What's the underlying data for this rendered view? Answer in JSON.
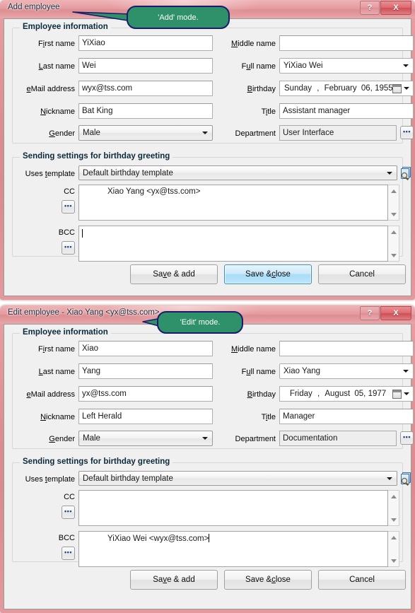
{
  "theme": {
    "frame_color": "#dd8e92",
    "callout_fill": "#2e9169",
    "callout_border": "#1b1b6e",
    "default_button_accent": "#a8dcf7"
  },
  "windows": [
    {
      "id": "add-employee",
      "title": "Add employee",
      "callout": "'Add' mode.",
      "caption": {
        "help": "?",
        "close": "X"
      },
      "groups": {
        "employee": {
          "title": "Employee information",
          "fields": {
            "first_name": {
              "label_pre": "F",
              "label_key": "i",
              "label_post": "rst name",
              "value": "YiXiao"
            },
            "last_name": {
              "label_pre": "",
              "label_key": "L",
              "label_post": "ast name",
              "value": "Wei"
            },
            "email": {
              "label_pre": "",
              "label_key": "e",
              "label_post": "Mail address",
              "value": "wyx@tss.com"
            },
            "nickname": {
              "label_pre": "",
              "label_key": "N",
              "label_post": "ickname",
              "value": "Bat King"
            },
            "gender": {
              "label_pre": "",
              "label_key": "G",
              "label_post": "ender",
              "value": "Male"
            },
            "middle_name": {
              "label_pre": "",
              "label_key": "M",
              "label_post": "iddle name",
              "value": ""
            },
            "full_name": {
              "label_pre": "F",
              "label_key": "u",
              "label_post": "ll name",
              "value": "YiXiao Wei"
            },
            "birthday": {
              "label_pre": "",
              "label_key": "B",
              "label_post": "irthday",
              "weekday": "Sunday",
              "comma": ",",
              "month": "February",
              "day": "06,",
              "year": "1955"
            },
            "title_field": {
              "label_pre": "T",
              "label_key": "i",
              "label_post": "tle",
              "value": "Assistant manager"
            },
            "department": {
              "label_pre": "",
              "label_key": "",
              "label_post": "Department",
              "value": "User Interface"
            }
          }
        },
        "sending": {
          "title": "Sending settings for birthday greeting",
          "fields": {
            "template": {
              "label_pre": "Uses ",
              "label_key": "t",
              "label_post": "emplate",
              "value": "Default birthday template"
            },
            "cc": {
              "label": "CC",
              "value": "Xiao Yang <yx@tss.com>",
              "has_caret": false
            },
            "bcc": {
              "label": "BCC",
              "value": "",
              "has_caret": true
            }
          }
        }
      },
      "buttons": {
        "save_add": {
          "pre": "Sa",
          "key": "v",
          "post": "e & add",
          "default": false
        },
        "save_close": {
          "pre": "Save & ",
          "key": "c",
          "post": "lose",
          "default": true
        },
        "cancel": {
          "pre": "Cancel",
          "key": "",
          "post": "",
          "default": false
        }
      }
    },
    {
      "id": "edit-employee",
      "title": "Edit employee - Xiao Yang <yx@tss.com>",
      "callout": "'Edit' mode.",
      "caption": {
        "help": "?",
        "close": "X"
      },
      "groups": {
        "employee": {
          "title": "Employee information",
          "fields": {
            "first_name": {
              "label_pre": "F",
              "label_key": "i",
              "label_post": "rst name",
              "value": "Xiao"
            },
            "last_name": {
              "label_pre": "",
              "label_key": "L",
              "label_post": "ast name",
              "value": "Yang"
            },
            "email": {
              "label_pre": "",
              "label_key": "e",
              "label_post": "Mail address",
              "value": "yx@tss.com"
            },
            "nickname": {
              "label_pre": "",
              "label_key": "N",
              "label_post": "ickname",
              "value": "Left Herald"
            },
            "gender": {
              "label_pre": "",
              "label_key": "G",
              "label_post": "ender",
              "value": "Male"
            },
            "middle_name": {
              "label_pre": "",
              "label_key": "M",
              "label_post": "iddle name",
              "value": ""
            },
            "full_name": {
              "label_pre": "F",
              "label_key": "u",
              "label_post": "ll name",
              "value": "Xiao Yang"
            },
            "birthday": {
              "label_pre": "",
              "label_key": "B",
              "label_post": "irthday",
              "weekday": "Friday",
              "comma": ",",
              "month": "August",
              "day": "05,",
              "year": "1977"
            },
            "title_field": {
              "label_pre": "T",
              "label_key": "i",
              "label_post": "tle",
              "value": "Manager"
            },
            "department": {
              "label_pre": "",
              "label_key": "",
              "label_post": "Department",
              "value": "Documentation"
            }
          }
        },
        "sending": {
          "title": "Sending settings for birthday greeting",
          "fields": {
            "template": {
              "label_pre": "Uses ",
              "label_key": "t",
              "label_post": "emplate",
              "value": "Default birthday template"
            },
            "cc": {
              "label": "CC",
              "value": "",
              "has_caret": false
            },
            "bcc": {
              "label": "BCC",
              "value": "YiXiao Wei <wyx@tss.com>",
              "has_caret": true
            }
          }
        }
      },
      "buttons": {
        "save_add": {
          "pre": "Sa",
          "key": "v",
          "post": "e & add",
          "default": false
        },
        "save_close": {
          "pre": "Save & ",
          "key": "c",
          "post": "lose",
          "default": false
        },
        "cancel": {
          "pre": "Cancel",
          "key": "",
          "post": "",
          "default": false
        }
      }
    }
  ]
}
